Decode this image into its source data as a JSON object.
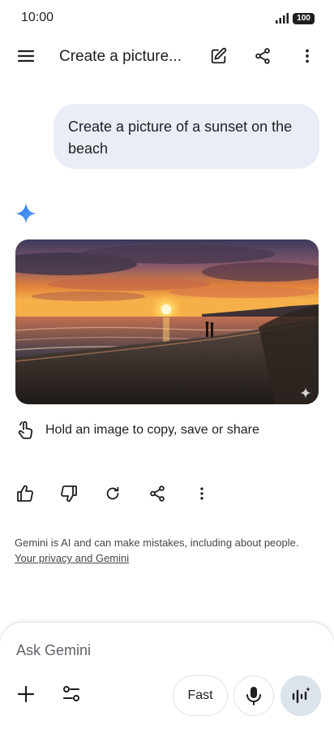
{
  "status_bar": {
    "time": "10:00",
    "battery": "100"
  },
  "app_bar": {
    "title": "Create a picture..."
  },
  "conversation": {
    "user_prompt": "Create a picture of a sunset on the beach",
    "image_hint": "Hold an image to copy, save or share"
  },
  "disclaimer": {
    "text": "Gemini is AI and can make mistakes, including about people.",
    "link": "Your privacy and Gemini"
  },
  "composer": {
    "placeholder": "Ask Gemini",
    "mode_label": "Fast"
  },
  "icons": {
    "menu": "menu-icon",
    "edit": "edit-icon",
    "share": "share-icon",
    "more": "more-vert-icon",
    "spark": "gemini-spark-icon",
    "touch": "touch-hold-icon",
    "thumbs_up": "thumbs-up-icon",
    "thumbs_down": "thumbs-down-icon",
    "regenerate": "refresh-icon",
    "plus": "plus-icon",
    "tools": "tools-icon",
    "mic": "mic-icon",
    "live": "live-icon"
  },
  "colors": {
    "accent": "#4285f4",
    "bubble_bg": "#e9eef6",
    "live_bg": "#dde3ea",
    "text": "#1f1f1f"
  }
}
